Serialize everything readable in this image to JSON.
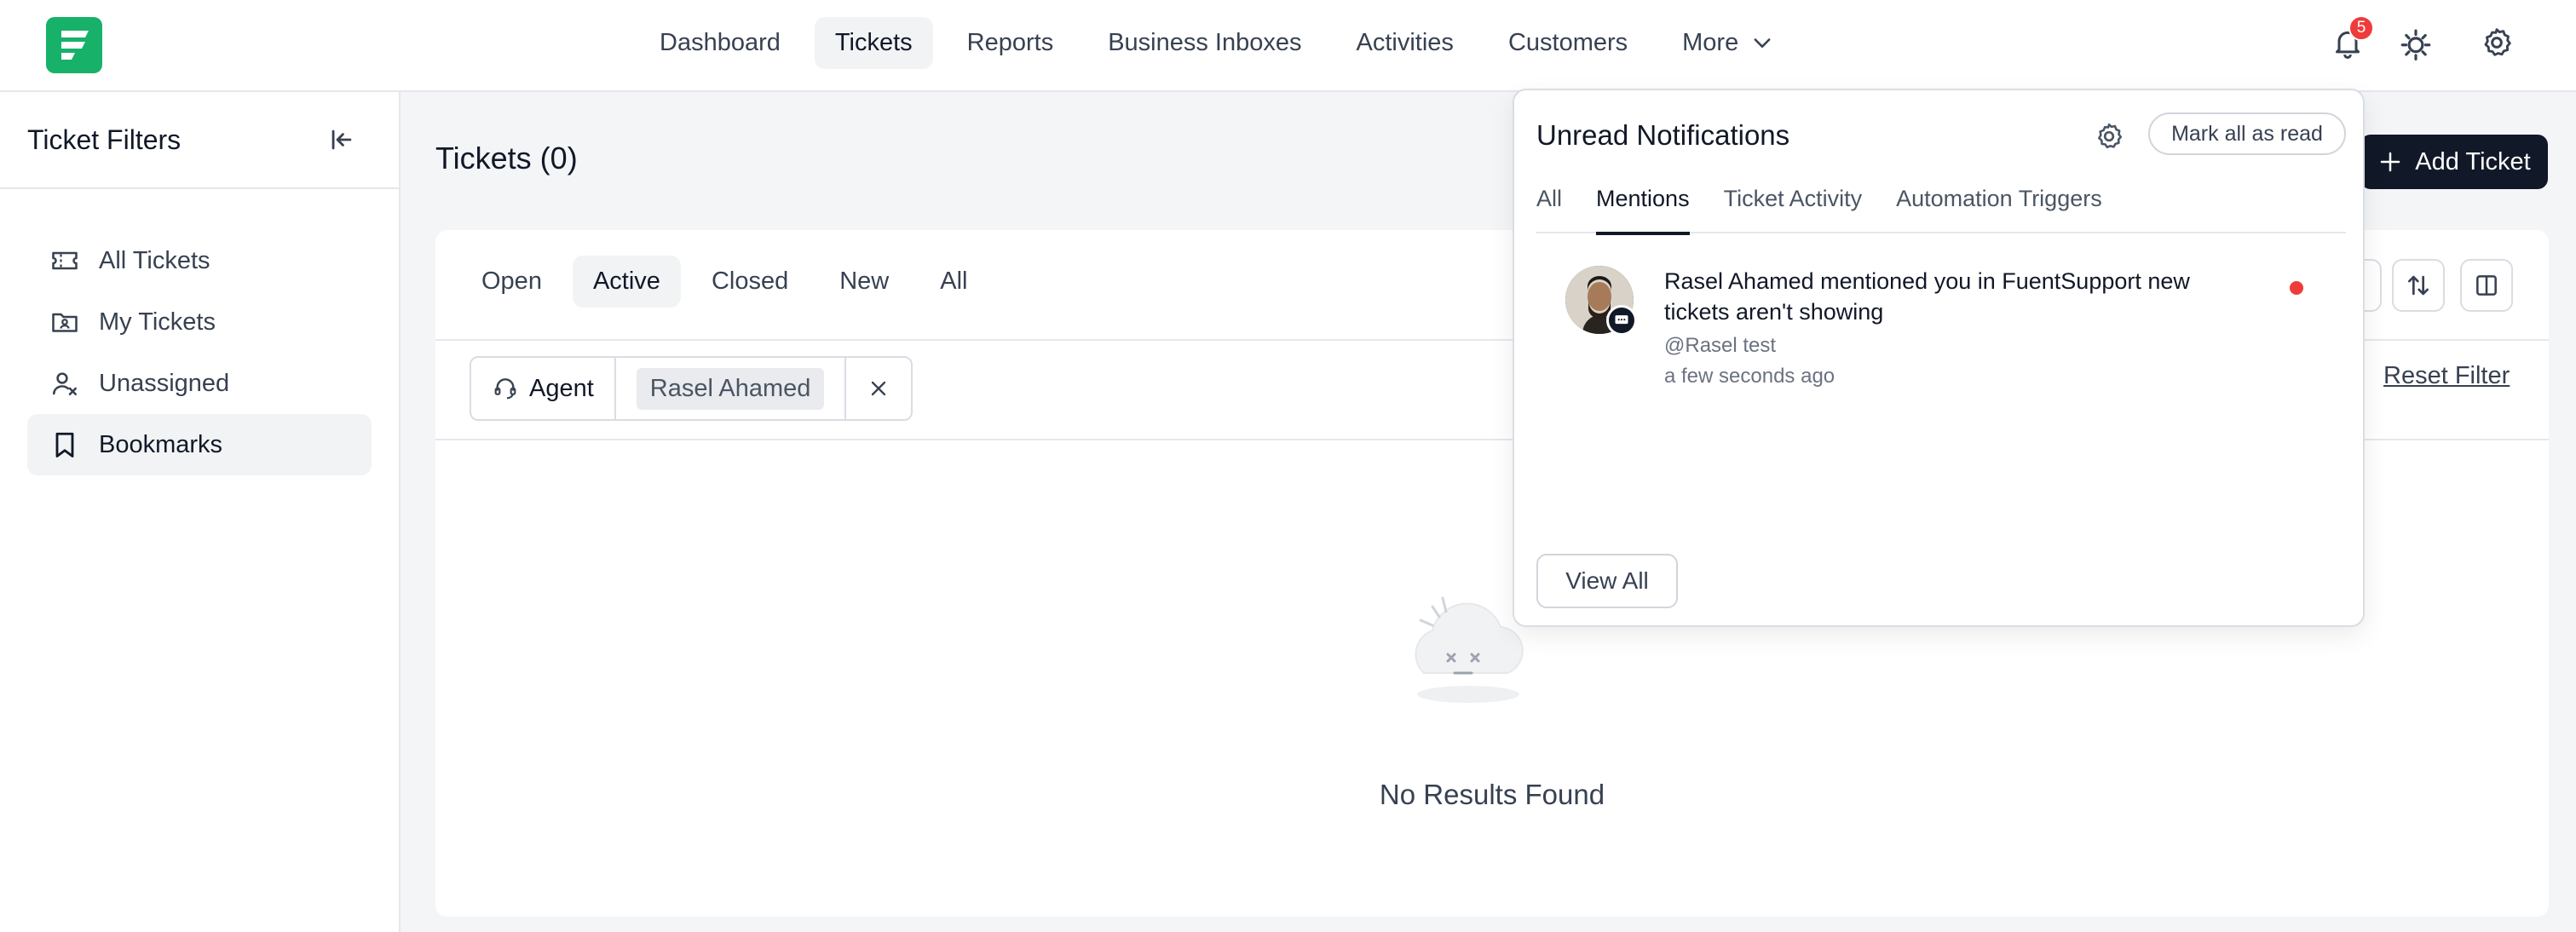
{
  "nav": {
    "items": [
      {
        "label": "Dashboard",
        "active": false
      },
      {
        "label": "Tickets",
        "active": true
      },
      {
        "label": "Reports",
        "active": false
      },
      {
        "label": "Business Inboxes",
        "active": false
      },
      {
        "label": "Activities",
        "active": false
      },
      {
        "label": "Customers",
        "active": false
      }
    ],
    "more_label": "More",
    "notification_count": "5",
    "brand_color": "#17b169"
  },
  "sidebar": {
    "title": "Ticket Filters",
    "items": [
      {
        "label": "All Tickets",
        "icon": "ticket-icon"
      },
      {
        "label": "My Tickets",
        "icon": "user-folder-icon"
      },
      {
        "label": "Unassigned",
        "icon": "user-x-icon"
      },
      {
        "label": "Bookmarks",
        "icon": "bookmark-icon",
        "active": true
      }
    ]
  },
  "main": {
    "title": "Tickets (0)",
    "add_ticket_label": "Add Ticket",
    "status_tabs": [
      "Open",
      "Active",
      "Closed",
      "New",
      "All"
    ],
    "active_status_tab": "Active",
    "filter": {
      "field_label": "Agent",
      "value": "Rasel Ahamed"
    },
    "reset_filter_label": "Reset Filter",
    "empty_text": "No Results Found"
  },
  "notifications": {
    "title": "Unread Notifications",
    "mark_all_label": "Mark all as read",
    "tabs": [
      "All",
      "Mentions",
      "Ticket Activity",
      "Automation Triggers"
    ],
    "active_tab": "Mentions",
    "items": [
      {
        "message": "Rasel Ahamed mentioned you in FuentSupport new tickets aren't showing",
        "sub": "@Rasel test",
        "time": "a few seconds ago",
        "unread": true
      }
    ],
    "view_all_label": "View All",
    "unread_color": "#ef3b3b"
  }
}
